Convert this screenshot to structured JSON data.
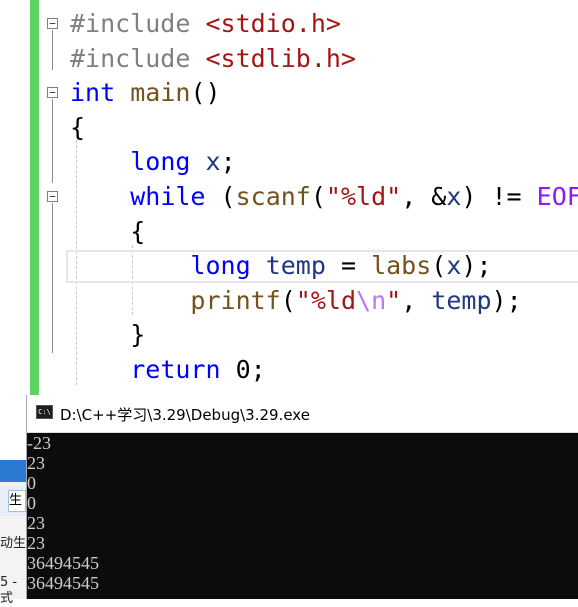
{
  "editor": {
    "lines": [
      {
        "parts": [
          {
            "c": "pp",
            "t": "#include "
          },
          {
            "c": "hdr",
            "t": "<stdio.h>"
          }
        ]
      },
      {
        "parts": [
          {
            "c": "pp",
            "t": "#include "
          },
          {
            "c": "hdr",
            "t": "<stdlib.h>"
          }
        ]
      },
      {
        "parts": [
          {
            "c": "kw",
            "t": "int"
          },
          {
            "c": "",
            "t": " "
          },
          {
            "c": "fn",
            "t": "main"
          },
          {
            "c": "",
            "t": "()"
          }
        ]
      },
      {
        "parts": [
          {
            "c": "",
            "t": "{"
          }
        ]
      },
      {
        "parts": [
          {
            "c": "",
            "t": "    "
          },
          {
            "c": "kw",
            "t": "long"
          },
          {
            "c": "",
            "t": " "
          },
          {
            "c": "var",
            "t": "x"
          },
          {
            "c": "",
            "t": ";"
          }
        ]
      },
      {
        "parts": [
          {
            "c": "",
            "t": "    "
          },
          {
            "c": "kw",
            "t": "while"
          },
          {
            "c": "",
            "t": " ("
          },
          {
            "c": "fn",
            "t": "scanf"
          },
          {
            "c": "",
            "t": "("
          },
          {
            "c": "str",
            "t": "\"%ld\""
          },
          {
            "c": "",
            "t": ", &"
          },
          {
            "c": "var",
            "t": "x"
          },
          {
            "c": "",
            "t": ") != "
          },
          {
            "c": "mac",
            "t": "EOF"
          },
          {
            "c": "",
            "t": ")"
          }
        ]
      },
      {
        "parts": [
          {
            "c": "",
            "t": "    {"
          }
        ]
      },
      {
        "parts": [
          {
            "c": "",
            "t": "        "
          },
          {
            "c": "kw",
            "t": "long"
          },
          {
            "c": "",
            "t": " "
          },
          {
            "c": "var",
            "t": "temp"
          },
          {
            "c": "",
            "t": " = "
          },
          {
            "c": "fn",
            "t": "labs"
          },
          {
            "c": "",
            "t": "("
          },
          {
            "c": "var",
            "t": "x"
          },
          {
            "c": "",
            "t": ");"
          }
        ]
      },
      {
        "parts": [
          {
            "c": "",
            "t": "        "
          },
          {
            "c": "fn",
            "t": "printf"
          },
          {
            "c": "",
            "t": "("
          },
          {
            "c": "str",
            "t": "\"%ld"
          },
          {
            "c": "esc",
            "t": "\\n"
          },
          {
            "c": "str",
            "t": "\""
          },
          {
            "c": "",
            "t": ", "
          },
          {
            "c": "var",
            "t": "temp"
          },
          {
            "c": "",
            "t": ");"
          }
        ]
      },
      {
        "parts": [
          {
            "c": "",
            "t": "    }"
          }
        ]
      },
      {
        "parts": [
          {
            "c": "",
            "t": "    "
          },
          {
            "c": "kw",
            "t": "return"
          },
          {
            "c": "",
            "t": " 0;"
          }
        ]
      }
    ],
    "fold_glyph": "−"
  },
  "console": {
    "icon_text": "C:\\",
    "title": "D:\\C++学习\\3.29\\Debug\\3.29.exe",
    "output": [
      "-23",
      "23",
      "0",
      "0",
      "23",
      "23",
      "36494545",
      "36494545"
    ]
  },
  "background_window": {
    "button_text": "生",
    "texts": [
      "动生",
      "5 -",
      "式"
    ]
  }
}
